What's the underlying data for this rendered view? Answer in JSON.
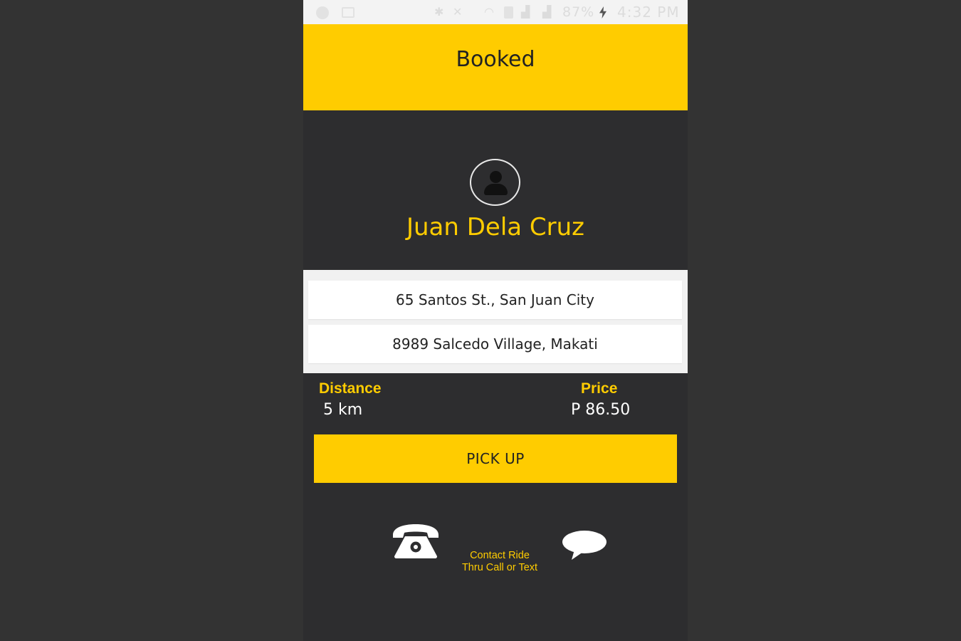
{
  "status_bar": {
    "battery": "87%",
    "time": "4:32 PM",
    "icons": [
      "clock-icon",
      "image-icon",
      "bluetooth-icon",
      "mute-icon",
      "wifi-icon",
      "sim-icon",
      "signal-icon",
      "signal-icon",
      "charging-icon"
    ]
  },
  "header": {
    "title": "Booked"
  },
  "rider": {
    "name": "Juan Dela Cruz",
    "avatar_icon": "user-avatar-icon"
  },
  "route": {
    "pickup": "65 Santos St., San Juan City",
    "dropoff": "8989 Salcedo Village, Makati"
  },
  "metrics": {
    "distance_label": "Distance",
    "distance_value": "5 km",
    "price_label": "Price",
    "price_value": "P 86.50"
  },
  "actions": {
    "pickup_label": "PICK UP",
    "contact_line1": "Contact Ride",
    "contact_line2": "Thru Call or Text",
    "call_icon": "phone-icon",
    "text_icon": "chat-bubble-icon"
  },
  "colors": {
    "accent": "#ffcc00",
    "background": "#2d2d2f",
    "outer_background": "#333333",
    "card": "#ffffff",
    "panel": "#f1f1f1"
  }
}
